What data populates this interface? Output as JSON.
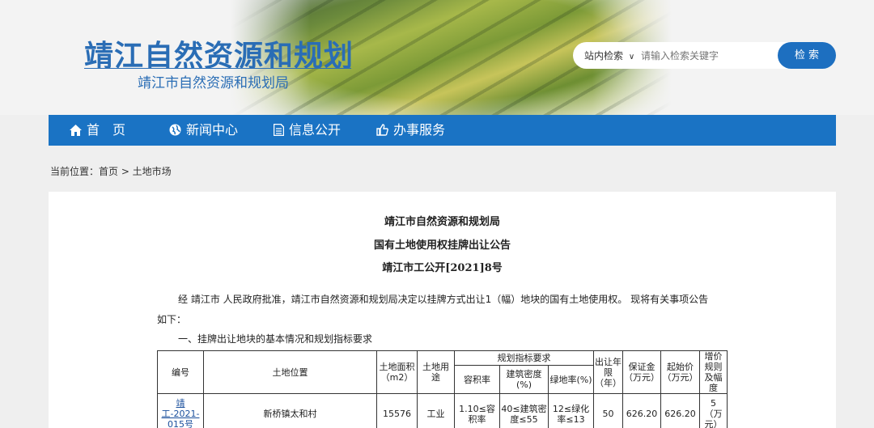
{
  "header": {
    "title": "靖江自然资源和规划",
    "subtitle": "靖江市自然资源和规划局",
    "search": {
      "scope": "站内检索",
      "placeholder": "请输入检索关键字",
      "button": "检 索"
    }
  },
  "nav": [
    {
      "label": "首　页",
      "icon": "home-icon"
    },
    {
      "label": "新闻中心",
      "icon": "globe-icon"
    },
    {
      "label": "信息公开",
      "icon": "document-icon"
    },
    {
      "label": "办事服务",
      "icon": "thumbs-up-icon"
    }
  ],
  "breadcrumb": "当前位置：首页 > 土地市场",
  "document": {
    "org": "靖江市自然资源和规划局",
    "title": "国有土地使用权挂牌出让公告",
    "number": "靖江市工公开[2021]8号",
    "intro_line1": "经 靖江市 人民政府批准，靖江市自然资源和规划局决定以挂牌方式出让1（幅）地块的国有土地使用权。 现将有关事项公告",
    "intro_line2": "如下：",
    "section1": "一、挂牌出让地块的基本情况和规划指标要求"
  },
  "table": {
    "headers": {
      "id": "编号",
      "location": "土地位置",
      "area": "土地面积（m2）",
      "use": "土地用途",
      "planning": "规划指标要求",
      "far": "容积率",
      "density": "建筑密度(%)",
      "green": "绿地率(%)",
      "term": "出让年限（年）",
      "deposit": "保证金（万元）",
      "start_price": "起始价（万元）",
      "increment": "增价规则及幅度"
    },
    "rows": [
      {
        "id": "靖工-2021-015号",
        "location": "新桥镇太和村",
        "area": "15576",
        "use": "工业",
        "far": "1.10≤容积率",
        "density": "40≤建筑密度≤55",
        "green": "12≤绿化率≤13",
        "term": "50",
        "deposit": "626.20",
        "start_price": "626.20",
        "increment": "5 （万元）"
      }
    ]
  }
}
